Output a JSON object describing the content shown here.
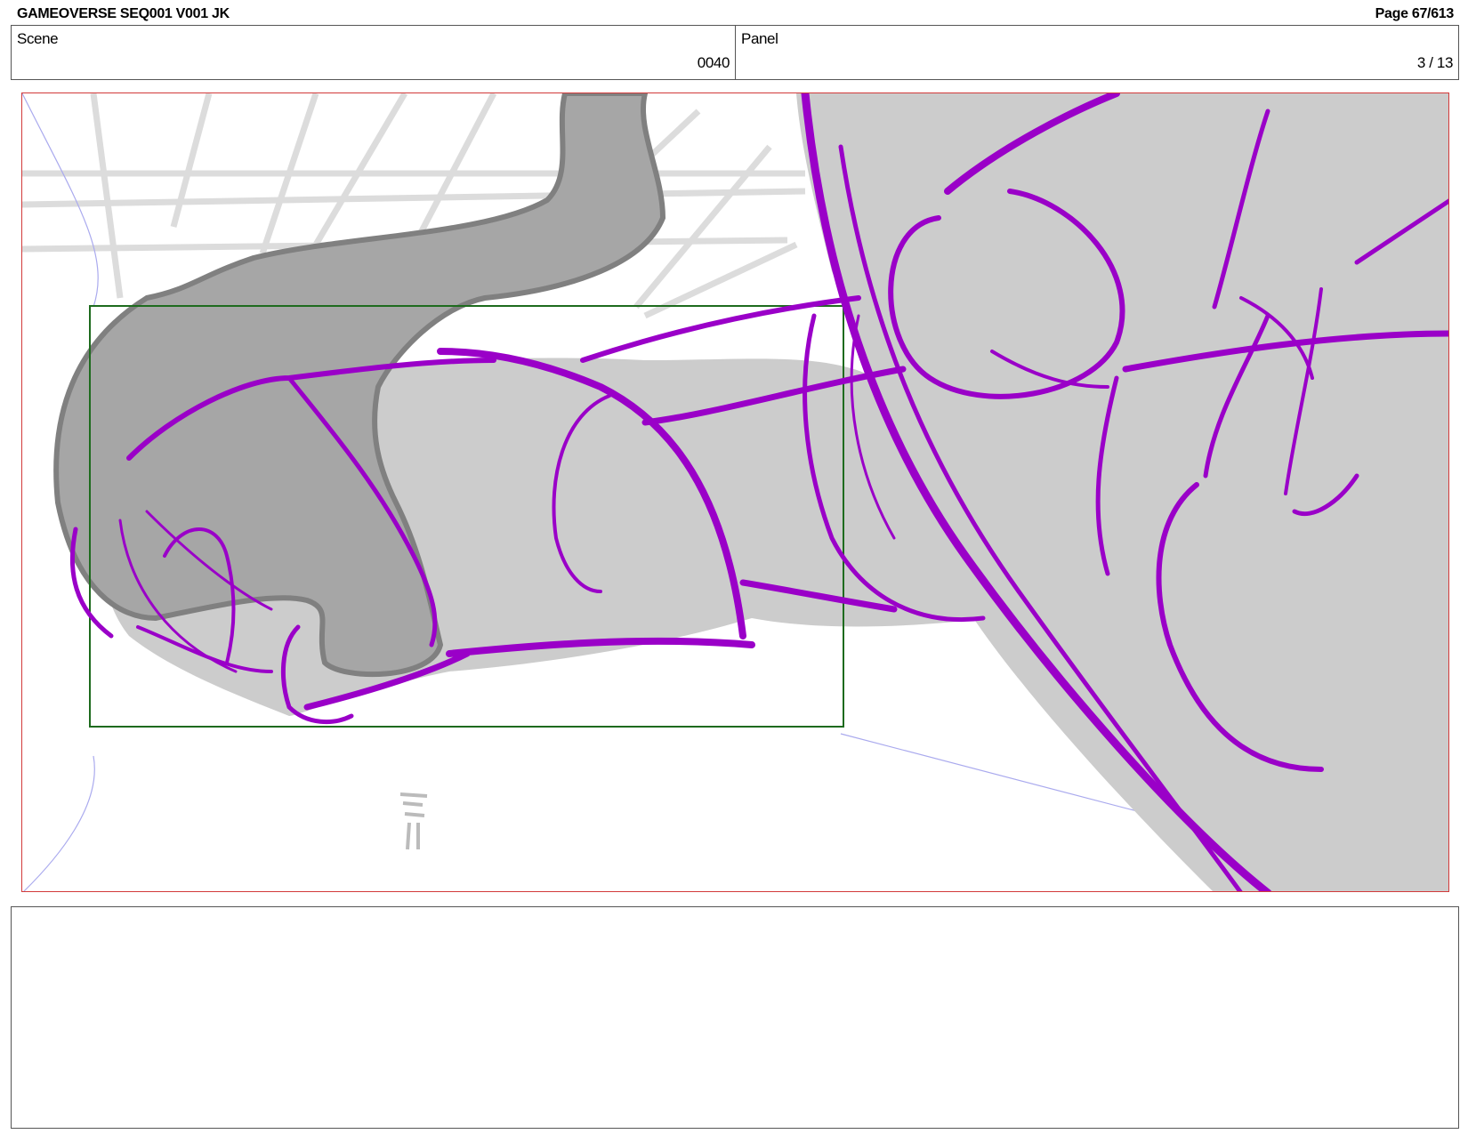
{
  "header": {
    "title": "GAMEOVERSE SEQ001 V001 JK",
    "page": "Page  67/613"
  },
  "info": {
    "scene_label": "Scene",
    "scene_value": "0040",
    "panel_label": "Panel",
    "panel_value": "3 / 13"
  },
  "frame": {
    "border_color": "#d23a3a",
    "camera_box_color": "#1e6b1e",
    "sketch_color": "#9a00c8",
    "fill_color": "#cccccc",
    "shadow_color": "#888888"
  },
  "notes": {
    "text": ""
  }
}
